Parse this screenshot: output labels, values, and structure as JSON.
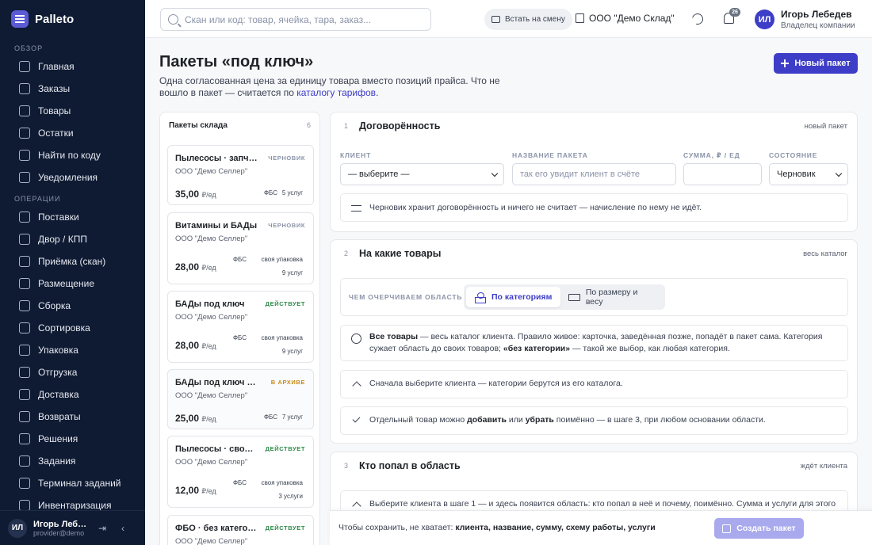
{
  "app": {
    "name": "Palleto"
  },
  "sidebar": {
    "sections": [
      {
        "title": "Обзор",
        "items": [
          {
            "label": "Главная",
            "icon": "grid-icon"
          },
          {
            "label": "Заказы",
            "icon": "cart-icon"
          },
          {
            "label": "Товары",
            "icon": "box-icon"
          },
          {
            "label": "Остатки",
            "icon": "stock-icon"
          },
          {
            "label": "Найти по коду",
            "icon": "search-icon"
          },
          {
            "label": "Уведомления",
            "icon": "bell-icon"
          }
        ]
      },
      {
        "title": "Операции",
        "items": [
          {
            "label": "Поставки",
            "icon": "truck-in-icon"
          },
          {
            "label": "Двор / КПП",
            "icon": "gate-icon"
          },
          {
            "label": "Приёмка (скан)",
            "icon": "scan-icon"
          },
          {
            "label": "Размещение",
            "icon": "shelf-icon"
          },
          {
            "label": "Сборка",
            "icon": "pick-icon"
          },
          {
            "label": "Сортировка",
            "icon": "sort-icon"
          },
          {
            "label": "Упаковка",
            "icon": "package-icon"
          },
          {
            "label": "Отгрузка",
            "icon": "ship-icon"
          },
          {
            "label": "Доставка",
            "icon": "delivery-icon"
          },
          {
            "label": "Возвраты",
            "icon": "return-icon"
          },
          {
            "label": "Решения",
            "icon": "decision-icon"
          },
          {
            "label": "Задания",
            "icon": "task-icon"
          },
          {
            "label": "Терминал заданий",
            "icon": "terminal-icon"
          },
          {
            "label": "Инвентаризация",
            "icon": "inventory-icon"
          }
        ]
      }
    ],
    "user": {
      "initials": "ИЛ",
      "name": "Игорь Лебедев",
      "email": "provider@demo"
    }
  },
  "header": {
    "search_placeholder": "Скан или код: товар, ячейка, тара, заказ...",
    "shift_label": "Встать на смену",
    "company": "ООО \"Демо Склад\"",
    "notifications_count": "26",
    "user": {
      "initials": "ИЛ",
      "name": "Игорь Лебедев",
      "role": "Владелец компании"
    }
  },
  "page": {
    "title": "Пакеты «под ключ»",
    "desc_before": "Одна согласованная цена за единицу товара вместо позиций прайса. Что не вошло в пакет — считается по ",
    "desc_link": "каталогу тарифов",
    "desc_after": ".",
    "new_button": "Новый пакет"
  },
  "packages": {
    "title": "Пакеты склада",
    "count": "6",
    "items": [
      {
        "name": "Пылесосы · запчасти",
        "status": "черновик",
        "status_kind": "draft",
        "seller": "ООО \"Демо Селлер\"",
        "price": "35,00",
        "unit": "₽/ед",
        "tags": [
          "ФБС",
          "5 услуг"
        ]
      },
      {
        "name": "Витамины и БАДы",
        "status": "черновик",
        "status_kind": "draft",
        "seller": "ООО \"Демо Селлер\"",
        "price": "28,00",
        "unit": "₽/ед",
        "tags": [
          "ФБС",
          "своя упаковка",
          "9 услуг"
        ]
      },
      {
        "name": "БАДы под ключ",
        "status": "действует",
        "status_kind": "active",
        "seller": "ООО \"Демо Селлер\"",
        "price": "28,00",
        "unit": "₽/ед",
        "tags": [
          "ФБС",
          "своя упаковка",
          "9 услуг"
        ]
      },
      {
        "name": "БАДы под ключ · архив",
        "status": "в архиве",
        "status_kind": "archive",
        "seller": "ООО \"Демо Селлер\"",
        "price": "25,00",
        "unit": "₽/ед",
        "tags": [
          "ФБС",
          "7 услуг"
        ]
      },
      {
        "name": "Пылесосы · своя упаковка",
        "status": "действует",
        "status_kind": "active",
        "seller": "ООО \"Демо Селлер\"",
        "price": "12,00",
        "unit": "₽/ед",
        "tags": [
          "ФБС",
          "своя упаковка",
          "3 услуги"
        ]
      },
      {
        "name": "ФБО · без категорий",
        "status": "действует",
        "status_kind": "active",
        "seller": "ООО \"Демо Селлер\"",
        "price": "",
        "unit": "",
        "tags": []
      }
    ]
  },
  "step1": {
    "num": "1",
    "title": "Договорённость",
    "meta": "новый пакет",
    "client_label": "Клиент",
    "client_value": "— выберите —",
    "name_label": "Название пакета",
    "name_placeholder": "так его увидит клиент в счёте",
    "sum_label": "Сумма, ₽ / ед",
    "sum_value": "",
    "state_label": "Состояние",
    "state_value": "Черновик",
    "note": "Черновик хранит договорённость и ничего не считает — начисление по нему не идёт."
  },
  "step2": {
    "num": "2",
    "title": "На какие товары",
    "meta": "весь каталог",
    "seg_label": "Чем очерчиваем область",
    "seg_options": [
      "По категориям",
      "По размеру и весу"
    ],
    "note_info_b1": "Все товары",
    "note_info_t1": " — весь каталог клиента. Правило живое: карточка, заведённая позже, попадёт в пакет сама. Категория сужает область до своих товаров; ",
    "note_info_b2": "«без категории»",
    "note_info_t2": " — такой же выбор, как любая категория.",
    "note_client": "Сначала выберите клиента — категории берутся из его каталога.",
    "note_item_t1": "Отдельный товар можно ",
    "note_item_b1": "добавить",
    "note_item_t2": " или ",
    "note_item_b2": "убрать",
    "note_item_t3": " поимённо — в шаге 3, при любом основании области."
  },
  "step3": {
    "num": "3",
    "title": "Кто попал в область",
    "meta": "ждёт клиента",
    "note": "Выберите клиента в шаге 1 — и здесь появится область: кто попал в неё и почему, поимённо. Сумма и услуги для этого не"
  },
  "savebar": {
    "text": "Чтобы сохранить, не хватает: ",
    "missing": "клиента, название, сумму, схему работы, услуги",
    "button": "Создать пакет"
  }
}
